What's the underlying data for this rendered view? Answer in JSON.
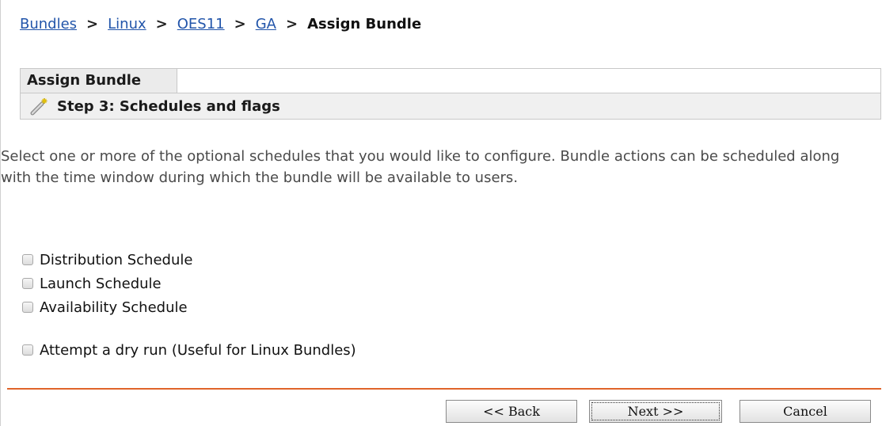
{
  "breadcrumb": {
    "items": [
      "Bundles",
      "Linux",
      "OES11",
      "GA"
    ],
    "current": "Assign Bundle"
  },
  "panel": {
    "tab_label": "Assign Bundle",
    "step_title": "Step 3: Schedules and flags"
  },
  "instructions": "Select one or more of the optional schedules that you would like to configure. Bundle actions can be scheduled along with the time window during which the bundle will be available to users.",
  "options": {
    "distribution": "Distribution Schedule",
    "launch": "Launch Schedule",
    "availability": "Availability Schedule",
    "dry_run": "Attempt a dry run (Useful for Linux Bundles)"
  },
  "buttons": {
    "back": "<< Back",
    "next": "Next >>",
    "cancel": "Cancel"
  },
  "colors": {
    "link": "#2255aa",
    "divider": "#e0642a"
  }
}
